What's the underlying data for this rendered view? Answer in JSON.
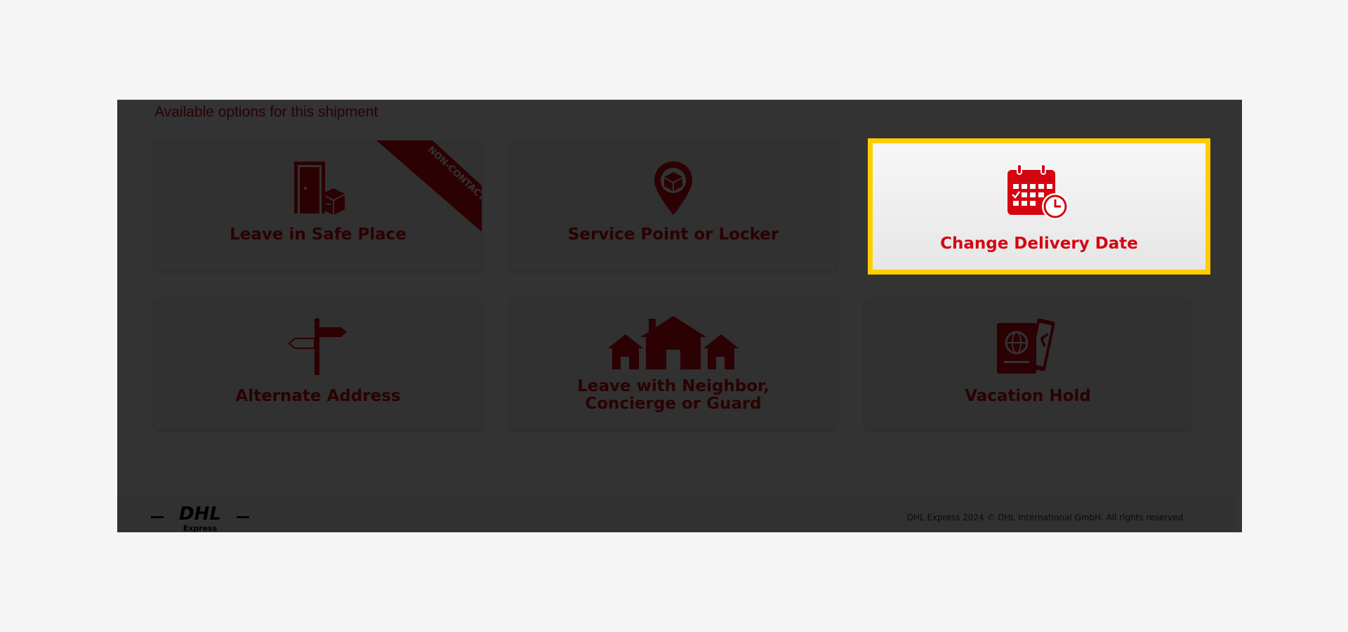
{
  "section": {
    "title": "Available options for this shipment"
  },
  "options": [
    {
      "label": "Leave in Safe Place",
      "icon": "door-package-icon",
      "badge": "NON-CONTACT"
    },
    {
      "label": "Service Point or Locker",
      "icon": "location-pin-package-icon"
    },
    {
      "label": "Change Delivery Date",
      "icon": "calendar-clock-icon",
      "highlighted": true
    },
    {
      "label": "Alternate Address",
      "icon": "signpost-icon"
    },
    {
      "label_line1": "Leave with Neighbor,",
      "label_line2": "Concierge or Guard",
      "icon": "houses-icon"
    },
    {
      "label": "Vacation Hold",
      "icon": "passport-ticket-icon"
    }
  ],
  "footer": {
    "logo_text": "DHL",
    "logo_subtext": "Express",
    "copyright": "DHL Express 2024 © DHL International GmbH. All rights reserved."
  },
  "colors": {
    "brand_red": "#d40511",
    "highlight_yellow": "#ffcc00",
    "overlay": "rgba(0,0,0,0.80)"
  }
}
